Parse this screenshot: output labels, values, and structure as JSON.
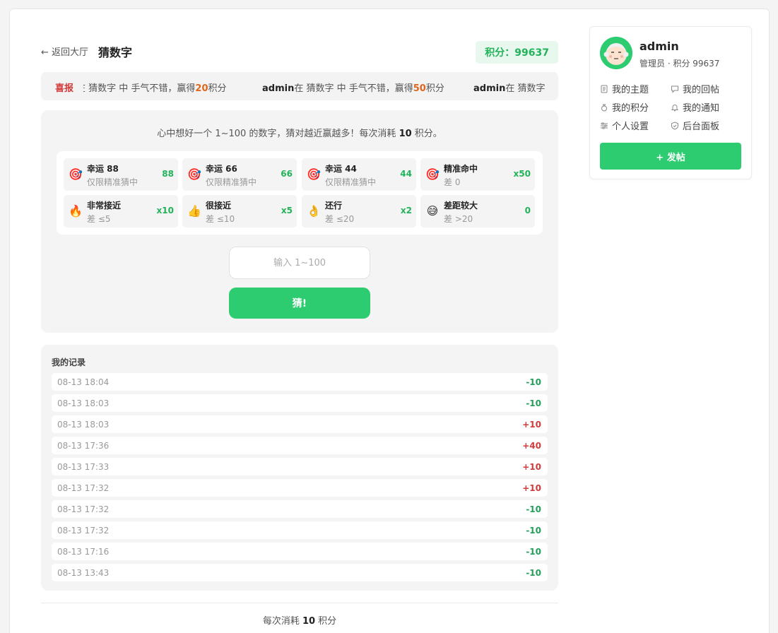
{
  "header": {
    "back_label": "← 返回大厅",
    "title": "猜数字",
    "score_label": "积分：99637"
  },
  "ticker": {
    "tag": "喜报",
    "items": [
      {
        "user": "",
        "prefix": "在 猜数字 中 手气不错，赢得",
        "points": "20",
        "suffix": "积分"
      },
      {
        "user": "admin",
        "prefix": "在 猜数字 中 手气不错，赢得",
        "points": "50",
        "suffix": "积分"
      },
      {
        "user": "admin",
        "prefix": "在 猜数字 中",
        "points": "",
        "suffix": ""
      }
    ]
  },
  "game": {
    "intro_before": "心中想好一个 1~100 的数字，猜对越近赢越多！每次消耗 ",
    "intro_cost": "10",
    "intro_after": " 积分。",
    "odds": [
      {
        "icon": "target-icon",
        "title": "幸运 88",
        "sub": "仅限精准猜中",
        "mult": "88"
      },
      {
        "icon": "target-icon",
        "title": "幸运 66",
        "sub": "仅限精准猜中",
        "mult": "66"
      },
      {
        "icon": "target-icon",
        "title": "幸运 44",
        "sub": "仅限精准猜中",
        "mult": "44"
      },
      {
        "icon": "target-icon",
        "title": "精准命中",
        "sub": "差 0",
        "mult": "x50"
      },
      {
        "icon": "fire-icon",
        "title": "非常接近",
        "sub": "差 ≤5",
        "mult": "x10"
      },
      {
        "icon": "thumbs-up-icon",
        "title": "很接近",
        "sub": "差 ≤10",
        "mult": "x5"
      },
      {
        "icon": "ok-hand-icon",
        "title": "还行",
        "sub": "差 ≤20",
        "mult": "x2"
      },
      {
        "icon": "sweat-smile-icon",
        "title": "差距较大",
        "sub": "差 >20",
        "mult": "0"
      }
    ],
    "input_placeholder": "输入 1~100",
    "guess_label": "猜!"
  },
  "records": {
    "title": "我的记录",
    "rows": [
      {
        "time": "08-13 18:04",
        "delta": "-10",
        "kind": "neg"
      },
      {
        "time": "08-13 18:03",
        "delta": "-10",
        "kind": "neg"
      },
      {
        "time": "08-13 18:03",
        "delta": "+10",
        "kind": "pos"
      },
      {
        "time": "08-13 17:36",
        "delta": "+40",
        "kind": "pos"
      },
      {
        "time": "08-13 17:33",
        "delta": "+10",
        "kind": "pos"
      },
      {
        "time": "08-13 17:32",
        "delta": "+10",
        "kind": "pos"
      },
      {
        "time": "08-13 17:32",
        "delta": "-10",
        "kind": "neg"
      },
      {
        "time": "08-13 17:32",
        "delta": "-10",
        "kind": "neg"
      },
      {
        "time": "08-13 17:16",
        "delta": "-10",
        "kind": "neg"
      },
      {
        "time": "08-13 13:43",
        "delta": "-10",
        "kind": "neg"
      }
    ]
  },
  "footer": {
    "before": "每次消耗 ",
    "cost": "10",
    "after": " 积分"
  },
  "sidebar": {
    "username": "admin",
    "meta": "管理员 · 积分 99637",
    "menu": [
      {
        "label": "我的主题",
        "icon": "document-icon"
      },
      {
        "label": "我的回帖",
        "icon": "comment-icon"
      },
      {
        "label": "我的积分",
        "icon": "money-bag-icon"
      },
      {
        "label": "我的通知",
        "icon": "bell-icon"
      },
      {
        "label": "个人设置",
        "icon": "sliders-icon"
      },
      {
        "label": "后台面板",
        "icon": "shield-icon"
      }
    ],
    "post_label": "+ 发帖"
  },
  "colors": {
    "accent": "#2ecc71",
    "gain": "#d33a3a",
    "loss": "#22a05a",
    "highlight": "#e0661d"
  }
}
